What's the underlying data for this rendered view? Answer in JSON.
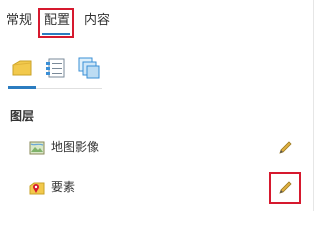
{
  "tabs": {
    "general": "常规",
    "config": "配置",
    "content": "内容",
    "active": "config"
  },
  "subtabs": [
    {
      "icon": "layer-folder-icon",
      "active": true
    },
    {
      "icon": "list-settings-icon",
      "active": false
    },
    {
      "icon": "stacked-pages-icon",
      "active": false
    }
  ],
  "section": {
    "title": "图层"
  },
  "layers": [
    {
      "label": "地图影像",
      "icon": "map-image-layer-icon",
      "action_icon": "pencil-edit-icon"
    },
    {
      "label": "要素",
      "icon": "feature-layer-icon",
      "action_icon": "pencil-edit-icon"
    }
  ],
  "colors": {
    "accent": "#2b7cc0",
    "highlight": "#d6192e",
    "folder_yellow": "#f2c94c",
    "pencil": "#e0b040"
  }
}
